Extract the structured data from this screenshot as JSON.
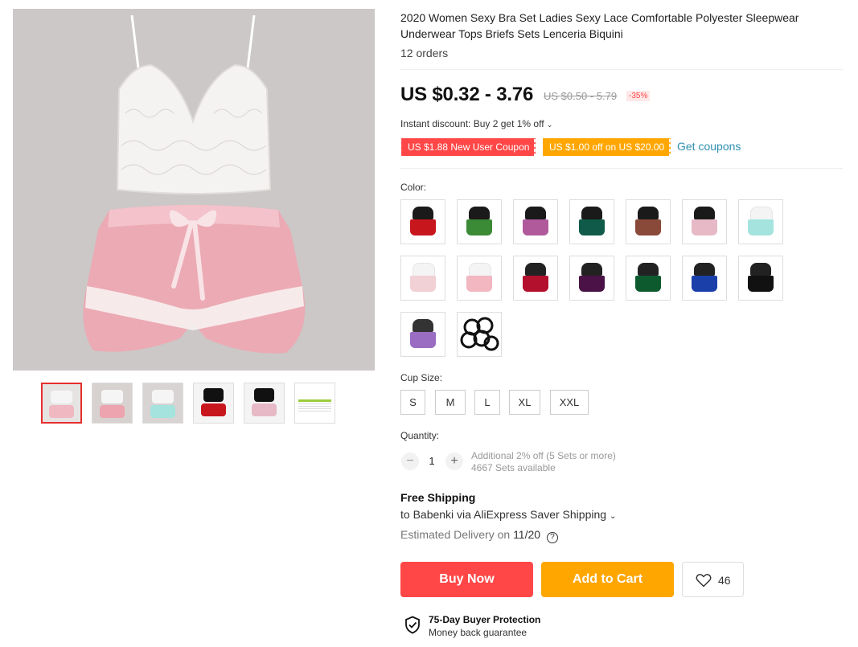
{
  "product": {
    "title": "2020 Women Sexy Bra Set Ladies Sexy Lace Comfortable Polyester Sleepwear Underwear Tops Briefs Sets Lenceria Biquini",
    "orders": "12 orders"
  },
  "price": {
    "current": "US $0.32 - 3.76",
    "original": "US $0.50 - 5.79",
    "discount": "-35%"
  },
  "discounts": {
    "instant": "Instant discount: Buy 2 get 1% off",
    "coupon_new_user": "US $1.88 New User Coupon",
    "coupon_store": "US $1.00 off on US $20.00",
    "get_coupons": "Get coupons"
  },
  "color": {
    "label": "Color:",
    "swatches": [
      {
        "top": "#1a1a1a",
        "bottom": "#c8161d"
      },
      {
        "top": "#1a1a1a",
        "bottom": "#3b8a35"
      },
      {
        "top": "#1a1a1a",
        "bottom": "#b05a9c"
      },
      {
        "top": "#1a1a1a",
        "bottom": "#0f5a48"
      },
      {
        "top": "#1a1a1a",
        "bottom": "#8a4a3a"
      },
      {
        "top": "#1a1a1a",
        "bottom": "#e7b9c6"
      },
      {
        "top": "#f4f4f4",
        "bottom": "#a5e4de"
      },
      {
        "top": "#f4f4f4",
        "bottom": "#f1d0d6"
      },
      {
        "top": "#f4f4f4",
        "bottom": "#f2b7c1"
      },
      {
        "top": "#222222",
        "bottom": "#b3102e"
      },
      {
        "top": "#222222",
        "bottom": "#4a1246"
      },
      {
        "top": "#222222",
        "bottom": "#0d5a2e"
      },
      {
        "top": "#222222",
        "bottom": "#1a3fa8"
      },
      {
        "top": "#222222",
        "bottom": "#111111"
      },
      {
        "top": "#333333",
        "bottom": "#9a6cc2"
      },
      {
        "top": "#ffffff",
        "bottom": "#ffffff"
      }
    ]
  },
  "cup_size": {
    "label": "Cup Size:",
    "options": [
      "S",
      "M",
      "L",
      "XL",
      "XXL"
    ]
  },
  "quantity": {
    "label": "Quantity:",
    "value": "1",
    "decrement": "−",
    "increment": "+",
    "note": "Additional 2% off (5 Sets or more)",
    "available": "4667 Sets available"
  },
  "shipping": {
    "title": "Free Shipping",
    "to": "to Babenki via AliExpress Saver Shipping",
    "delivery_label": "Estimated Delivery on",
    "delivery_date": "11/20"
  },
  "actions": {
    "buy_now": "Buy Now",
    "add_to_cart": "Add to Cart",
    "wishlist_count": "46"
  },
  "protection": {
    "title": "75-Day Buyer Protection",
    "subtitle": "Money back guarantee"
  },
  "colors": {
    "accent_red": "#ff4747",
    "accent_orange": "#ffa600",
    "link_blue": "#2e8fb0"
  }
}
